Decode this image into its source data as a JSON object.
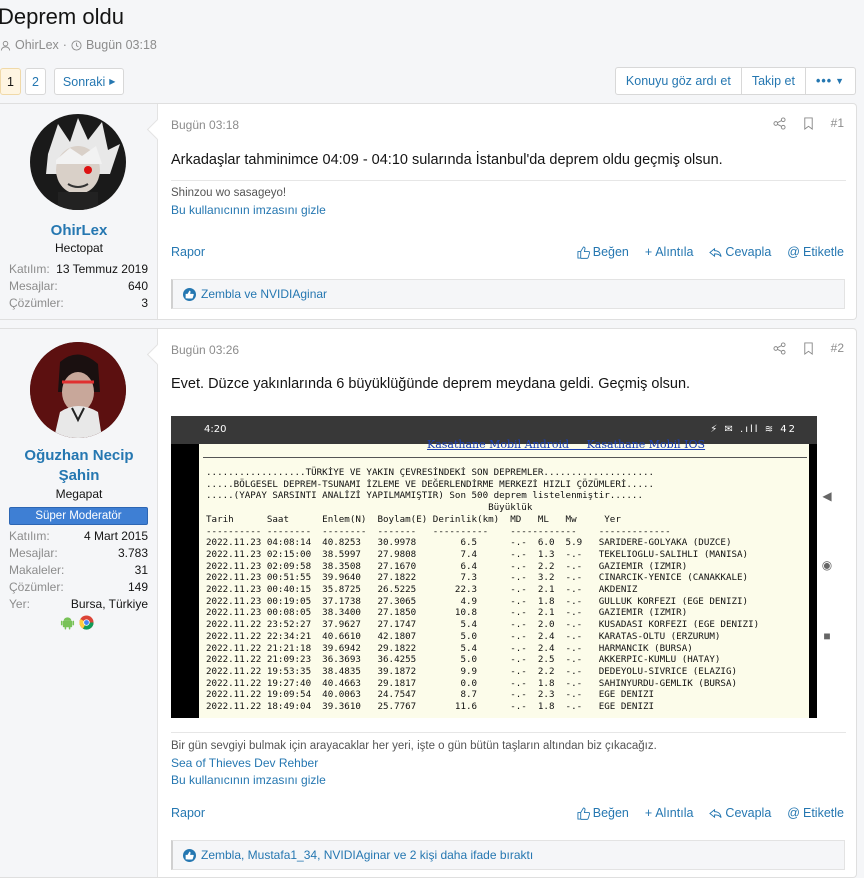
{
  "thread": {
    "title": "Deprem oldu",
    "author": "OhirLex",
    "date": "Bugün 03:18"
  },
  "pagination": {
    "pages": [
      "1",
      "2"
    ],
    "current": "1",
    "next_label": "Sonraki"
  },
  "thread_actions": {
    "ignore": "Konuyu göz ardı et",
    "watch": "Takip et",
    "more": "•••"
  },
  "posts": [
    {
      "username": "OhirLex",
      "user_title": "Hectopat",
      "stats": [
        {
          "label": "Katılım:",
          "value": "13 Temmuz 2019"
        },
        {
          "label": "Mesajlar:",
          "value": "640"
        },
        {
          "label": "Çözümler:",
          "value": "3"
        }
      ],
      "date": "Bugün 03:18",
      "number": "#1",
      "body": "Arkadaşlar tahminimce 04:09 - 04:10 sularında İstanbul'da deprem oldu geçmiş olsun.",
      "signature_text": "Shinzou wo sasageyo!",
      "hide_signature": "Bu kullanıcının imzasını gizle",
      "report": "Rapor",
      "like": "Beğen",
      "quote": "Alıntıla",
      "reply": "Cevapla",
      "tag": "Etiketle",
      "reactions": "Zembla ve NVIDIAginar"
    },
    {
      "username_line1": "Oğuzhan Necip",
      "username_line2": "Şahin",
      "user_title": "Megapat",
      "badge": "Süper Moderatör",
      "stats": [
        {
          "label": "Katılım:",
          "value": "4 Mart 2015"
        },
        {
          "label": "Mesajlar:",
          "value": "3.783"
        },
        {
          "label": "Makaleler:",
          "value": "31"
        },
        {
          "label": "Çözümler:",
          "value": "149"
        },
        {
          "label": "Yer:",
          "value": "Bursa, Türkiye"
        }
      ],
      "date": "Bugün 03:26",
      "number": "#2",
      "body": "Evet. Düzce yakınlarında 6 büyüklüğünde deprem meydana geldi. Geçmiş olsun.",
      "signature_text": "Bir gün sevgiyi bulmak için arayacaklar her yeri, işte o gün bütün taşların altından biz çıkacağız.",
      "signature_link": "Sea of Thieves Dev Rehber",
      "hide_signature": "Bu kullanıcının imzasını gizle",
      "report": "Rapor",
      "like": "Beğen",
      "quote": "Alıntıla",
      "reply": "Cevapla",
      "tag": "Etiketle",
      "reactions": "Zembla, Mustafa1_34, NVIDIAginar ve 2 kişi daha ifade bıraktı"
    }
  ],
  "screenshot": {
    "time": "4:20",
    "status_icons": "⚡ ✉ .ıll ≋ 42",
    "header_links": "Kasathane Mobil Android     Kasathane Mobil IOS",
    "lines": [
      "..................TÜRKİYE VE YAKIN ÇEVRESİNDEKİ SON DEPREMLER....................",
      ".....BÖLGESEL DEPREM-TSUNAMI İZLEME VE DEĞERLENDİRME MERKEZİ HIZLI ÇÖZÜMLERİ.....",
      ".....(YAPAY SARSINTI ANALİZİ YAPILMAMIŞTIR) Son 500 deprem listelenmiştir......",
      "                                                   Büyüklük",
      "Tarih      Saat      Enlem(N)  Boylam(E) Derinlik(km)  MD   ML   Mw     Yer",
      "---------- --------  --------  -------   ----------    ------------    -------------",
      "2022.11.23 04:08:14  40.8253   30.9978        6.5      -.-  6.0  5.9   SARIDERE-GOLYAKA (DUZCE)",
      "2022.11.23 02:15:00  38.5997   27.9808        7.4      -.-  1.3  -.-   TEKELIOGLU-SALIHLI (MANISA)",
      "2022.11.23 02:09:58  38.3508   27.1670        6.4      -.-  2.2  -.-   GAZIEMIR (IZMIR)",
      "2022.11.23 00:51:55  39.9640   27.1822        7.3      -.-  3.2  -.-   CINARCIK-YENICE (CANAKKALE)",
      "2022.11.23 00:40:15  35.8725   26.5225       22.3      -.-  2.1  -.-   AKDENIZ",
      "2022.11.23 00:19:05  37.1738   27.3065        4.9      -.-  1.8  -.-   GULLUK KORFEZI (EGE DENIZI)",
      "2022.11.23 00:08:05  38.3400   27.1850       10.8      -.-  2.1  -.-   GAZIEMIR (IZMIR)",
      "2022.11.22 23:52:27  37.9627   27.1747        5.4      -.-  2.0  -.-   KUSADASI KORFEZI (EGE DENIZI)",
      "2022.11.22 22:34:21  40.6610   42.1807        5.0      -.-  2.4  -.-   KARATAS-OLTU (ERZURUM)",
      "2022.11.22 21:21:18  39.6942   29.1822        5.4      -.-  2.4  -.-   HARMANCIK (BURSA)",
      "2022.11.22 21:09:23  36.3693   36.4255        5.0      -.-  2.5  -.-   AKKERPIC-KUMLU (HATAY)",
      "2022.11.22 19:53:35  38.4835   39.1872        9.9      -.-  2.2  -.-   DEDEYOLU-SIVRICE (ELAZIG)",
      "2022.11.22 19:27:40  40.4663   29.1817        0.0      -.-  1.8  -.-   SAHINYURDU-GEMLIK (BURSA)",
      "2022.11.22 19:09:54  40.0063   24.7547        8.7      -.-  2.3  -.-   EGE DENIZI",
      "2022.11.22 18:49:04  39.3610   25.7767       11.6      -.-  1.8  -.-   EGE DENIZI"
    ]
  }
}
